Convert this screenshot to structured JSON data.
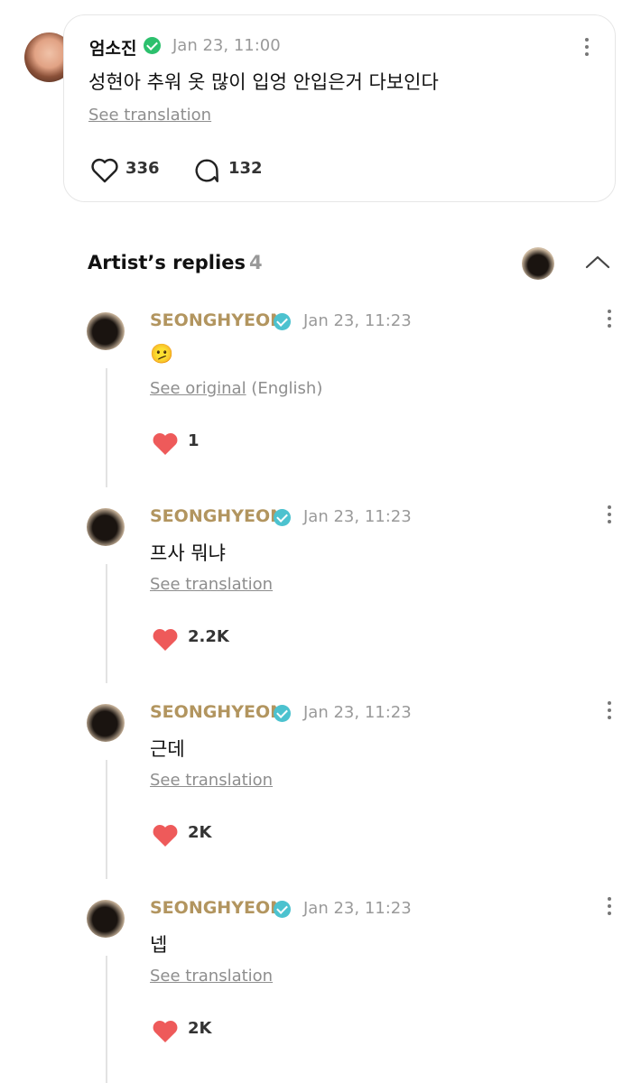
{
  "post": {
    "author": "엄소진",
    "time": "Jan 23, 11:00",
    "body": "성현아 추워 옷 많이 입엉 안입은거 다보인다",
    "translation_link": "See translation",
    "likes": "336",
    "comments": "132"
  },
  "replies_section": {
    "title": "Artist’s replies",
    "count": "4"
  },
  "replies": [
    {
      "author": "SEONGHYEON",
      "time": "Jan 23, 11:23",
      "body": "🫤",
      "translation_link": "See original",
      "translation_note": " (English)",
      "likes": "1"
    },
    {
      "author": "SEONGHYEON",
      "time": "Jan 23, 11:23",
      "body": "프사 뭐냐",
      "translation_link": "See translation",
      "translation_note": "",
      "likes": "2.2K"
    },
    {
      "author": "SEONGHYEON",
      "time": "Jan 23, 11:23",
      "body": "근데",
      "translation_link": "See translation",
      "translation_note": "",
      "likes": "2K"
    },
    {
      "author": "SEONGHYEON",
      "time": "Jan 23, 11:23",
      "body": "넵",
      "translation_link": "See translation",
      "translation_note": "",
      "likes": "2K"
    }
  ],
  "colors": {
    "artist_name": "#b2955f",
    "heart": "#ee5a5a",
    "verified_fan": "#2cc06d",
    "verified_artist": "#4cc2cf"
  }
}
